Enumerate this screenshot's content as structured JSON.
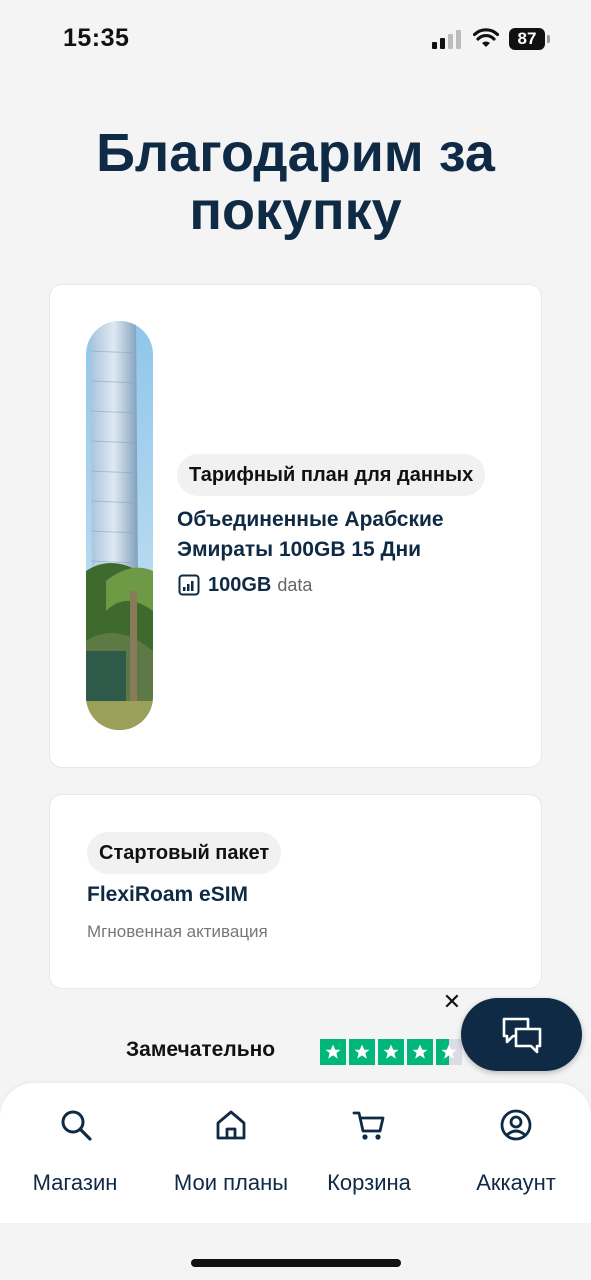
{
  "status_bar": {
    "time": "15:35",
    "battery": "87"
  },
  "page": {
    "title": "Благодарим за покупку"
  },
  "plan_card": {
    "badge": "Тарифный план для данных",
    "name": "Объединенные Арабские Эмираты 100GB 15 Дни",
    "data_value": "100GB",
    "data_unit": "data",
    "image": "dubai-tower-photo"
  },
  "starter_card": {
    "badge": "Стартовый пакет",
    "name": "FlexiRoam eSIM",
    "subtitle": "Мгновенная активация"
  },
  "review": {
    "label": "Замечательно",
    "stars": 4.5,
    "star_color": "#00b67a"
  },
  "chat": {
    "icon": "chat-bubbles-icon"
  },
  "tabs": [
    {
      "label": "Магазин",
      "icon": "search-icon"
    },
    {
      "label": "Мои планы",
      "icon": "home-icon"
    },
    {
      "label": "Корзина",
      "icon": "cart-icon"
    },
    {
      "label": "Аккаунт",
      "icon": "user-icon"
    }
  ],
  "colors": {
    "navy": "#0f2a44",
    "background": "#f4f4f4",
    "trustpilot": "#00b67a"
  }
}
